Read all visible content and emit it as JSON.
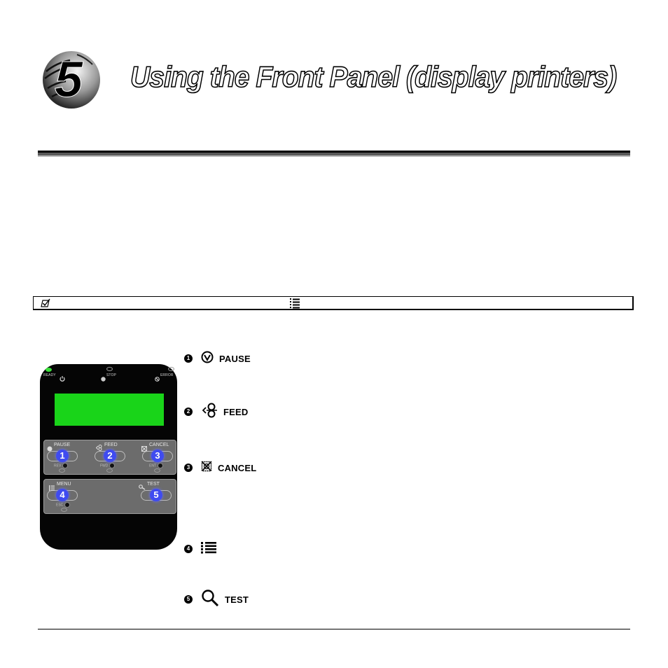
{
  "chapter": {
    "number": "5",
    "title": "Using the Front Panel (display printers)"
  },
  "note": {
    "icon": "checkbox-note-icon",
    "inline_icon": "menu-list-icon"
  },
  "front_panel": {
    "indicators": [
      {
        "label": "READY",
        "icon": "power-icon",
        "state": "on",
        "color": "#3be03b"
      },
      {
        "label": "STOP",
        "icon": "stop-icon",
        "state": "off"
      },
      {
        "label": "ERROR",
        "icon": "error-icon",
        "state": "off"
      }
    ],
    "display_color": "#19d419",
    "keys": [
      {
        "number": "1",
        "label": "PAUSE",
        "icon": "pause-icon",
        "secondary": "REV"
      },
      {
        "number": "2",
        "label": "FEED",
        "icon": "feed-icon",
        "secondary": "FWD"
      },
      {
        "number": "3",
        "label": "CANCEL",
        "icon": "cancel-icon",
        "secondary": "ENT"
      },
      {
        "number": "4",
        "label": "MENU",
        "icon": "menu-icon",
        "secondary": "ESC"
      },
      {
        "number": "5",
        "label": "TEST",
        "icon": "test-icon",
        "secondary": ""
      }
    ],
    "key_number_color": "#3f4bf0"
  },
  "callouts": [
    {
      "marker": "1",
      "icon": "pause-icon",
      "label": "PAUSE"
    },
    {
      "marker": "2",
      "icon": "feed-icon",
      "label": "FEED"
    },
    {
      "marker": "3",
      "icon": "cancel-icon",
      "label": "CANCEL"
    },
    {
      "marker": "4",
      "icon": "menu-icon",
      "label": ""
    },
    {
      "marker": "5",
      "icon": "test-icon",
      "label": "TEST"
    }
  ]
}
